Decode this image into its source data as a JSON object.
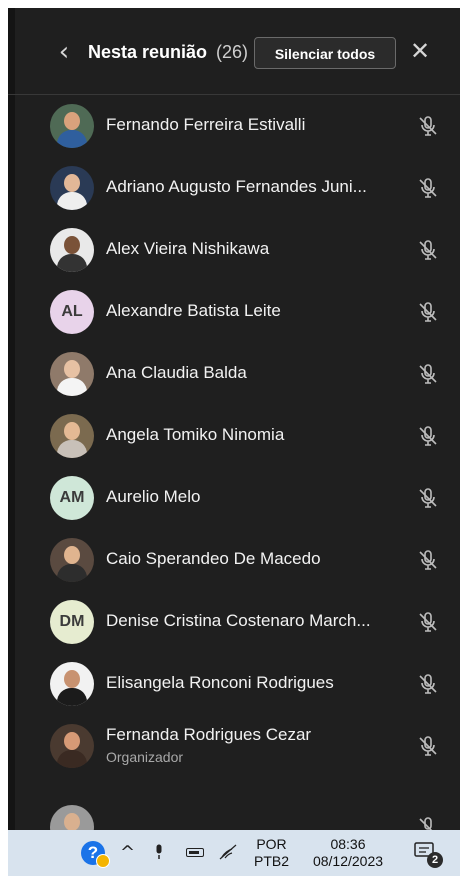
{
  "header": {
    "back_icon": "chevron-left-icon",
    "title": "Nesta reunião",
    "count": "(26)",
    "mute_all_label": "Silenciar todos",
    "close_icon": "close-icon"
  },
  "participants": [
    {
      "name": "Fernando Ferreira Estivalli",
      "avatar": "photo",
      "mic": "mic-off-icon"
    },
    {
      "name": "Adriano Augusto Fernandes Juni...",
      "avatar": "photo",
      "mic": "mic-off-icon"
    },
    {
      "name": "Alex Vieira Nishikawa",
      "avatar": "photo",
      "mic": "mic-off-icon"
    },
    {
      "name": "Alexandre Batista Leite",
      "avatar": "initials",
      "initials": "AL",
      "avatar_color": "#e8d3ea",
      "mic": "mic-off-icon"
    },
    {
      "name": "Ana Claudia Balda",
      "avatar": "photo",
      "mic": "mic-off-icon"
    },
    {
      "name": "Angela Tomiko Ninomia",
      "avatar": "photo",
      "mic": "mic-off-icon"
    },
    {
      "name": "Aurelio Melo",
      "avatar": "initials",
      "initials": "AM",
      "avatar_color": "#cfe7d8",
      "mic": "mic-off-icon"
    },
    {
      "name": "Caio Sperandeo De Macedo",
      "avatar": "photo",
      "mic": "mic-off-icon"
    },
    {
      "name": "Denise Cristina Costenaro March...",
      "avatar": "initials",
      "initials": "DM",
      "avatar_color": "#e6ecd0",
      "mic": "mic-off-icon"
    },
    {
      "name": "Elisangela Ronconi Rodrigues",
      "avatar": "photo",
      "mic": "mic-off-icon"
    },
    {
      "name": "Fernanda Rodrigues Cezar",
      "role": "Organizador",
      "avatar": "photo",
      "mic": "mic-off-icon"
    }
  ],
  "taskbar": {
    "help_icon": "help-icon",
    "help_label": "?",
    "show_hidden_icon": "chevron-up-icon",
    "mic_icon": "microphone-icon",
    "battery_icon": "battery-icon",
    "wifi_icon": "wifi-icon",
    "lang_line1": "POR",
    "lang_line2": "PTB2",
    "time": "08:36",
    "date": "08/12/2023",
    "notification_icon": "notification-icon",
    "notification_count": "2"
  },
  "colors": {
    "panel_bg": "#1f1f1f",
    "taskbar_bg": "#d8e3ee"
  }
}
